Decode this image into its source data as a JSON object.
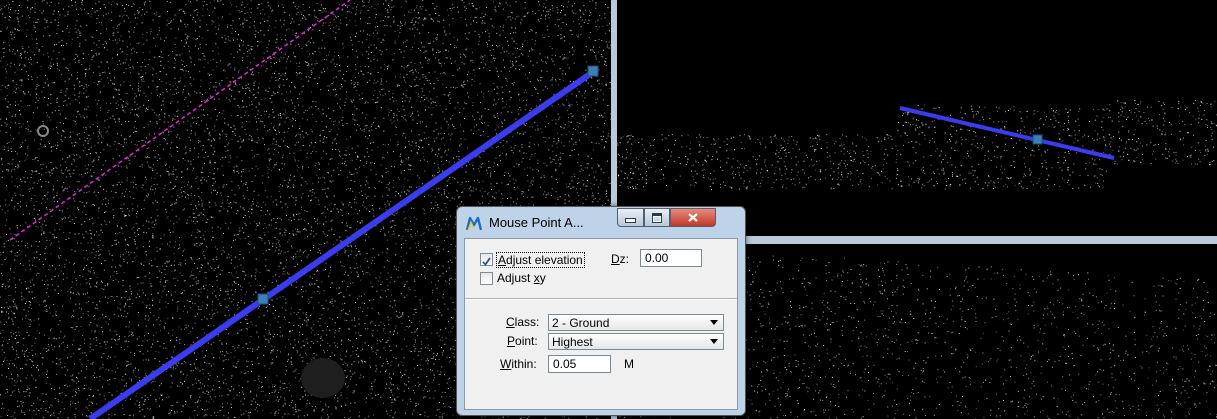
{
  "dialog": {
    "title": "Mouse Point A...",
    "adjust_elevation": {
      "label_key": "A",
      "label_rest": "djust elevation",
      "checked": true
    },
    "dz": {
      "label_key": "D",
      "label_rest": "z:",
      "value": "0.00"
    },
    "adjust_xy": {
      "label_pre": "Adjust ",
      "label_key": "x",
      "label_rest": "y",
      "checked": false
    },
    "class": {
      "label_key": "C",
      "label_rest": "lass:",
      "value": "2 - Ground"
    },
    "point": {
      "label_key": "P",
      "label_rest": "oint:",
      "value": "Highest"
    },
    "within": {
      "label_key": "W",
      "label_rest": "ithin:",
      "value": "0.05",
      "unit": "M"
    }
  },
  "colors": {
    "breakline_blue": "#3a3cf0",
    "dashed_magenta": "#e020d8",
    "vertex_marker": "#3c7fb8",
    "divider": "#b9c9d8",
    "dialog_frame": "#bfd3e8"
  },
  "icons": {
    "app": "mouse-point-adjust-icon",
    "minimize": "minimize-icon",
    "maximize": "maximize-icon",
    "close": "close-icon"
  }
}
